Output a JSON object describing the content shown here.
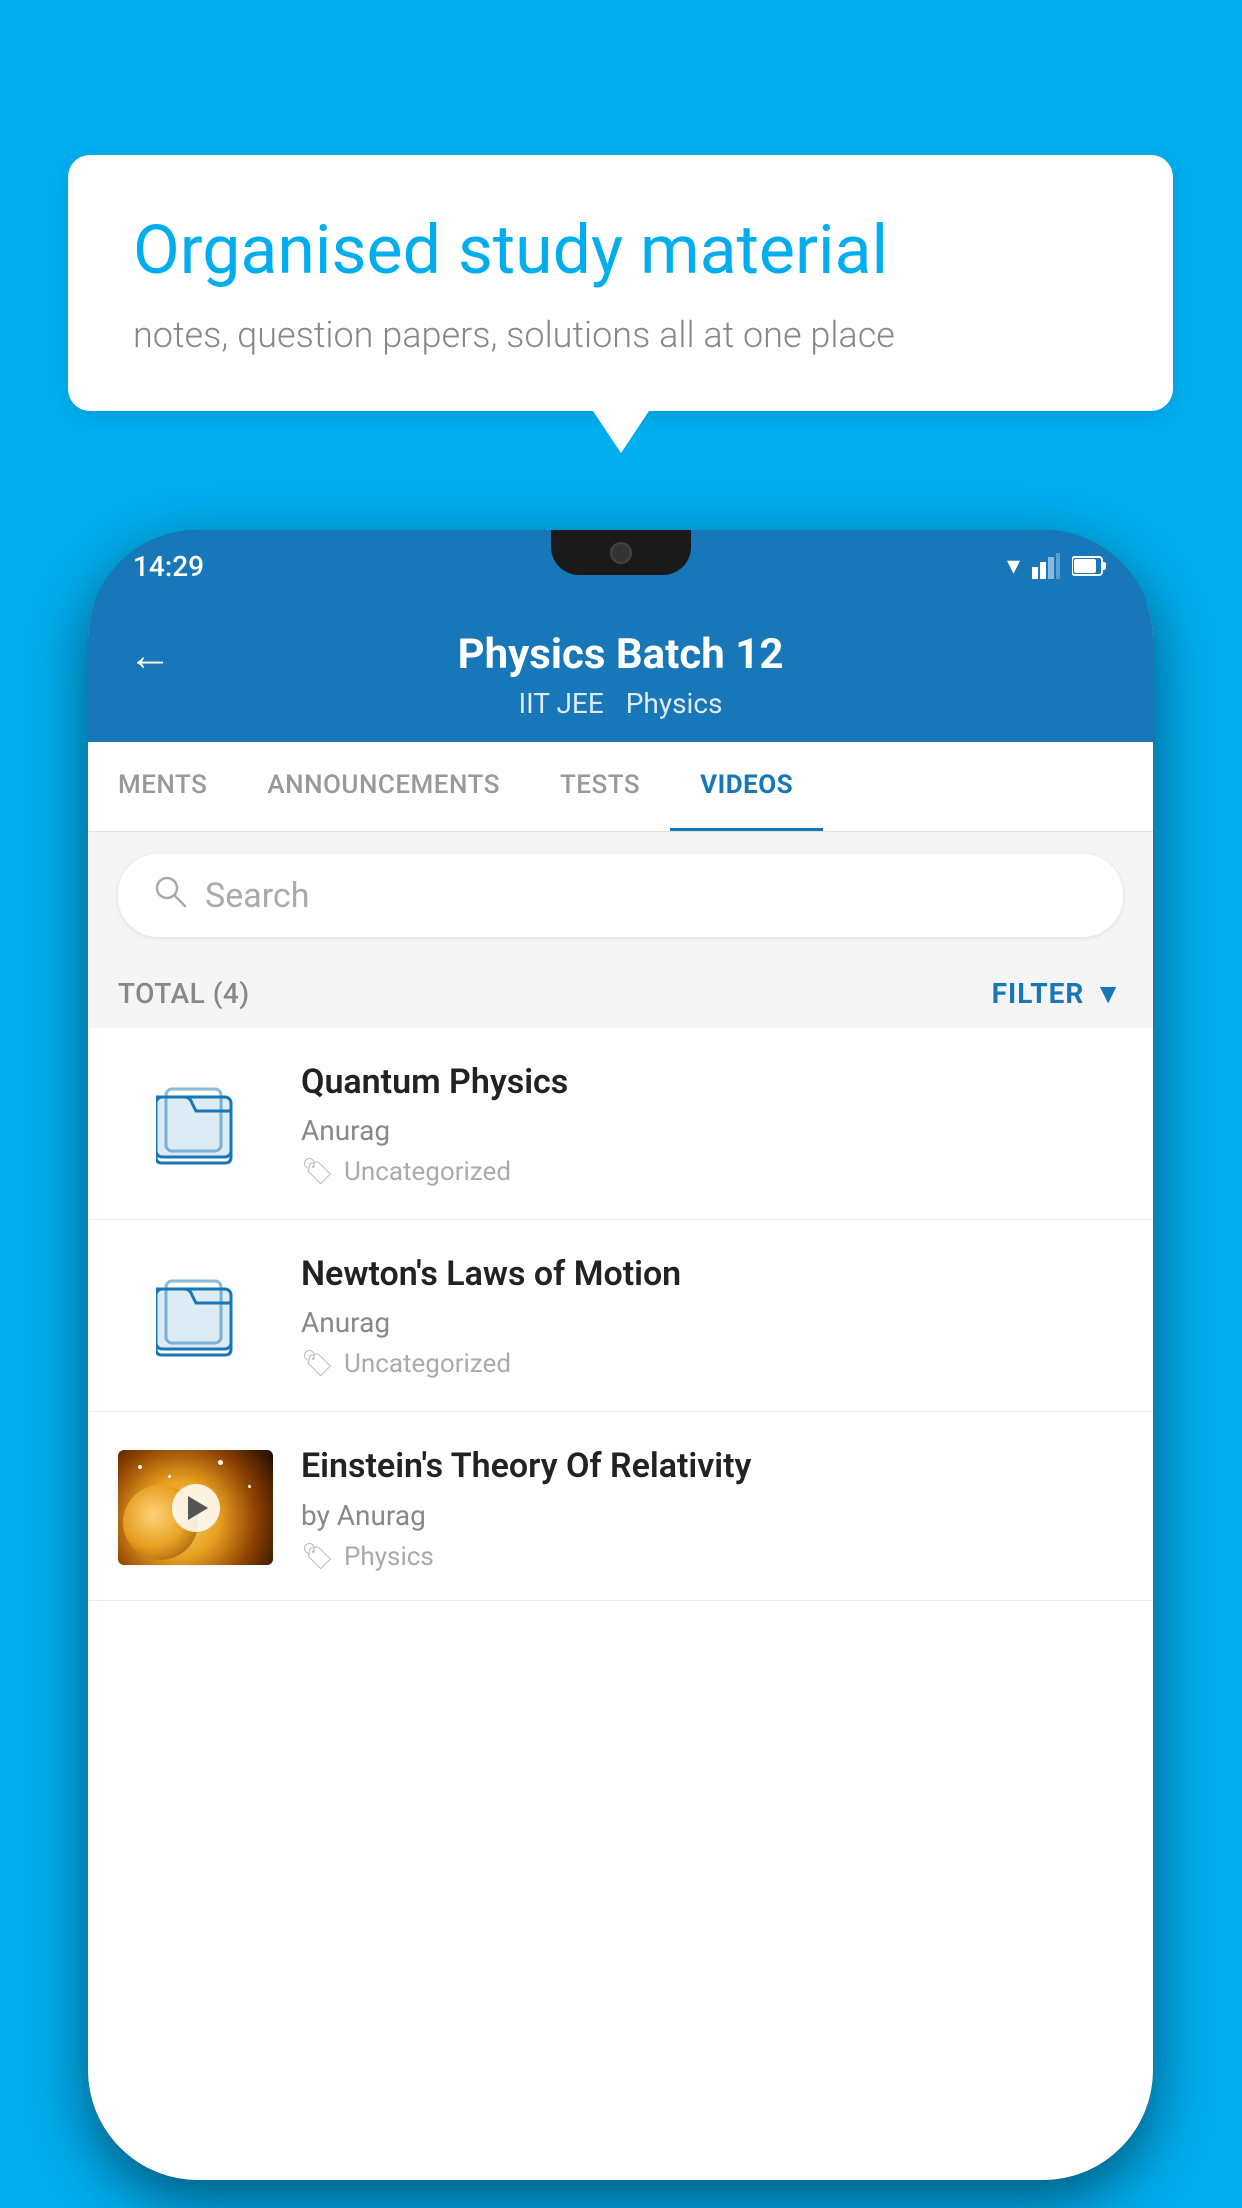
{
  "bubble": {
    "title": "Organised study material",
    "subtitle": "notes, question papers, solutions all at one place"
  },
  "phone": {
    "status": {
      "time": "14:29"
    },
    "header": {
      "title": "Physics Batch 12",
      "tag1": "IIT JEE",
      "tag2": "Physics",
      "back_label": "←"
    },
    "tabs": [
      {
        "label": "MENTS",
        "active": false
      },
      {
        "label": "ANNOUNCEMENTS",
        "active": false
      },
      {
        "label": "TESTS",
        "active": false
      },
      {
        "label": "VIDEOS",
        "active": true
      }
    ],
    "search": {
      "placeholder": "Search"
    },
    "filter": {
      "total_label": "TOTAL (4)",
      "filter_label": "FILTER"
    },
    "videos": [
      {
        "title": "Quantum Physics",
        "author": "Anurag",
        "tag": "Uncategorized",
        "type": "folder"
      },
      {
        "title": "Newton's Laws of Motion",
        "author": "Anurag",
        "tag": "Uncategorized",
        "type": "folder"
      },
      {
        "title": "Einstein's Theory Of Relativity",
        "author": "by Anurag",
        "tag": "Physics",
        "type": "video"
      }
    ]
  }
}
